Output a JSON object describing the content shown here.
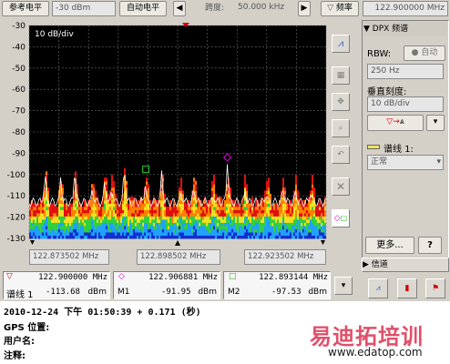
{
  "toolbar": {
    "ref_level_label": "参考电平",
    "ref_level_value": "-30 dBm",
    "auto_level_label": "自动电平",
    "span_label": "跨度:",
    "span_value": "50.000 kHz",
    "freq_label": "频率",
    "freq_value": "122.900000 MHz"
  },
  "chart_data": {
    "type": "heatmap",
    "title": "",
    "scale_label": "10 dB/div",
    "y_ticks": [
      "-30",
      "-40",
      "-50",
      "-60",
      "-70",
      "-80",
      "-90",
      "-100",
      "-110",
      "-120",
      "-130"
    ],
    "ylim": [
      -130,
      -30
    ],
    "xlim": [
      122.873502,
      122.923502
    ],
    "x_tick_labels": [
      "122.873502 MHz",
      "122.898502 MHz",
      "122.923502 MHz"
    ],
    "grid": true,
    "markers": [
      {
        "name": "M1",
        "x": 122.906881,
        "y": -91.95
      },
      {
        "name": "M2",
        "x": 122.893144,
        "y": -97.53
      }
    ]
  },
  "side_panel": {
    "title": "DPX 频谱",
    "rbw_label": "RBW:",
    "rbw_auto": "自动",
    "rbw_value": "250 Hz",
    "vscale_label": "垂直刻度:",
    "vscale_value": "10 dB/div",
    "trace_label": "谱线 1:",
    "trace_mode": "正常",
    "more_label": "更多...",
    "help_label": "?",
    "channel_title": "信道"
  },
  "markers_bar": {
    "ref_freq": "122.900000 MHz",
    "ref_trace": "谱线 1",
    "ref_level": "-113.68",
    "ref_unit": "dBm",
    "m1_freq": "122.906881 MHz",
    "m1_name": "M1",
    "m1_level": "-91.95",
    "m1_unit": "dBm",
    "m2_freq": "122.893144 MHz",
    "m2_name": "M2",
    "m2_level": "-97.53",
    "m2_unit": "dBm"
  },
  "status": {
    "timestamp": "2010-12-24 下午 01:50:39 + 0.171 (秒)",
    "gps_label": "GPS 位置:",
    "user_label": "用户名:",
    "note_label": "注释:"
  },
  "watermark": {
    "cn": "易迪拓培训",
    "url": "www.edatop.com"
  },
  "colors": {
    "plot_bg": "#000000",
    "grid": "#6a6a6a",
    "marker_ref": "#d00000",
    "marker_m1": "#c000c0",
    "marker_m2": "#20b020",
    "watermark": "#e0506a"
  }
}
